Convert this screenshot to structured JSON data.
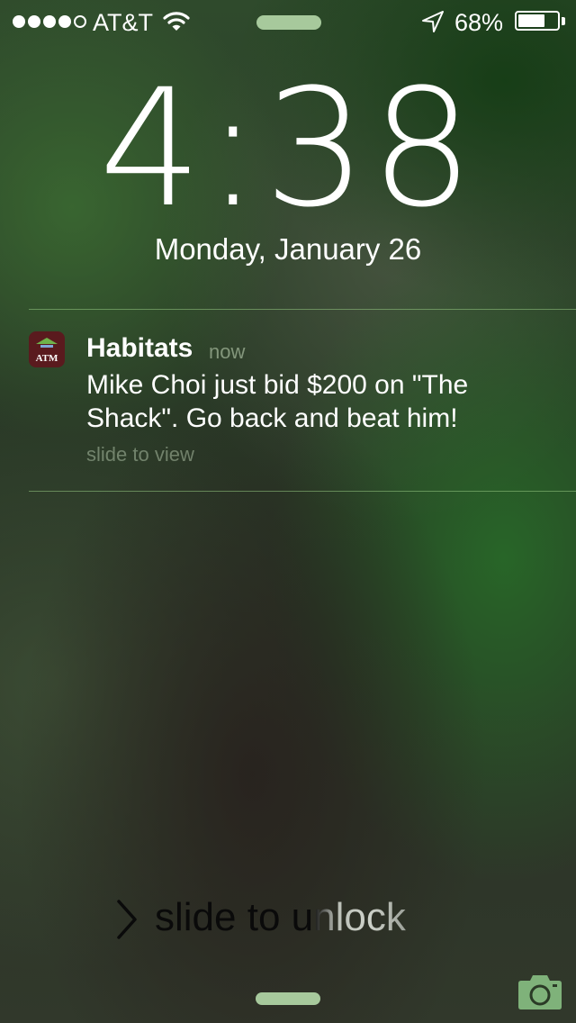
{
  "status_bar": {
    "carrier": "AT&T",
    "signal_bars": 4,
    "signal_max": 5,
    "battery_percent": "68%",
    "battery_level": 0.68,
    "icons": [
      "signal-dots-icon",
      "wifi-icon",
      "location-arrow-icon",
      "battery-icon"
    ]
  },
  "lock_screen": {
    "time": "4:38",
    "date": "Monday, January 26",
    "unlock_label": "slide to unlock"
  },
  "notification": {
    "app_name": "Habitats",
    "time": "now",
    "message": "Mike Choi just bid $200 on \"The Shack\". Go back and beat him!",
    "action_hint": "slide to view",
    "icon_text": "ATM",
    "icon_colors": {
      "background": "#5a1a1e",
      "roof": "#6fb24a",
      "mark": "#ffffff"
    }
  },
  "colors": {
    "grabber": "#a7c99c",
    "divider": "#96c882",
    "camera": "#7fb27a"
  }
}
